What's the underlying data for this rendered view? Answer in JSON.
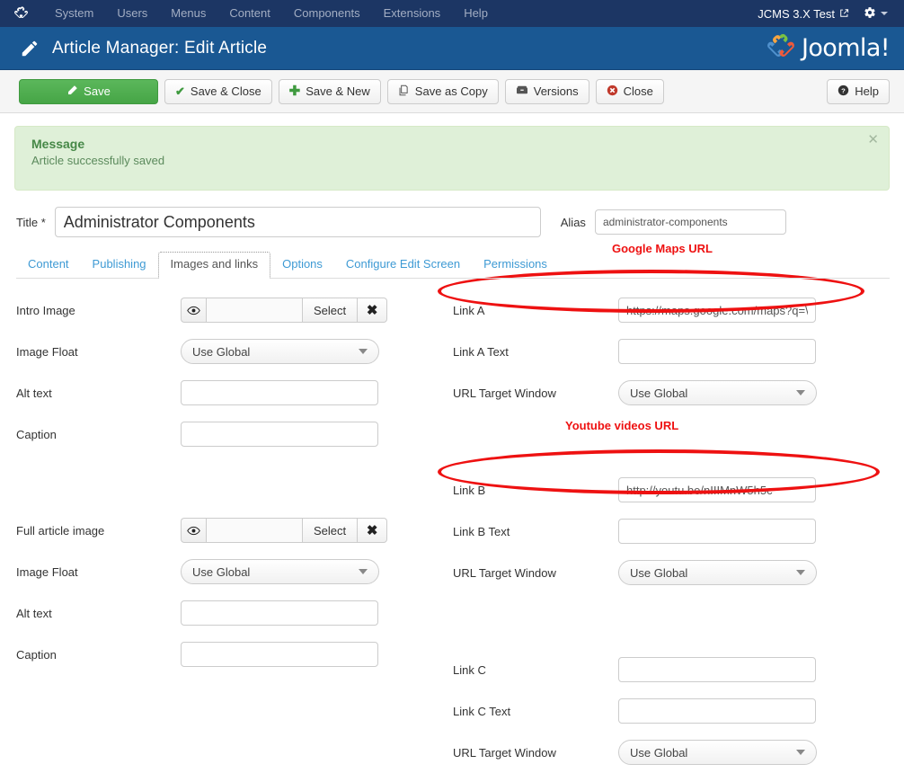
{
  "topbar": {
    "brand_icon": "joomla-logo-icon",
    "menu": [
      {
        "label": "System"
      },
      {
        "label": "Users"
      },
      {
        "label": "Menus"
      },
      {
        "label": "Content"
      },
      {
        "label": "Components"
      },
      {
        "label": "Extensions"
      },
      {
        "label": "Help"
      }
    ],
    "site_name": "JCMS 3.X Test",
    "site_link_icon": "external-link-icon",
    "gear_icon": "gear-icon",
    "caret_icon": "chevron-down-icon"
  },
  "titlebar": {
    "icon": "pencil-icon",
    "title": "Article Manager: Edit Article",
    "logo_text": "Joomla!"
  },
  "toolbar": {
    "save": "Save",
    "save_close": "Save & Close",
    "save_new": "Save & New",
    "save_copy": "Save as Copy",
    "versions": "Versions",
    "close": "Close",
    "help": "Help"
  },
  "alert": {
    "title": "Message",
    "text": "Article successfully saved",
    "close_icon": "close-icon"
  },
  "title_row": {
    "title_label": "Title *",
    "title_value": "Administrator Components",
    "alias_label": "Alias",
    "alias_value": "administrator-components"
  },
  "tabs": [
    {
      "label": "Content",
      "active": false
    },
    {
      "label": "Publishing",
      "active": false
    },
    {
      "label": "Images and links",
      "active": true
    },
    {
      "label": "Options",
      "active": false
    },
    {
      "label": "Configure Edit Screen",
      "active": false
    },
    {
      "label": "Permissions",
      "active": false
    }
  ],
  "left_column": {
    "intro_image": {
      "label": "Intro Image",
      "value": "",
      "select_label": "Select",
      "clear_label": "✖",
      "eye_icon": "eye-icon"
    },
    "intro_float": {
      "label": "Image Float",
      "value": "Use Global"
    },
    "intro_alt": {
      "label": "Alt text",
      "value": ""
    },
    "intro_caption": {
      "label": "Caption",
      "value": ""
    },
    "full_image": {
      "label": "Full article image",
      "value": "",
      "select_label": "Select",
      "clear_label": "✖",
      "eye_icon": "eye-icon"
    },
    "full_float": {
      "label": "Image Float",
      "value": "Use Global"
    },
    "full_alt": {
      "label": "Alt text",
      "value": ""
    },
    "full_caption": {
      "label": "Caption",
      "value": ""
    }
  },
  "right_column": {
    "link_a": {
      "label": "Link A",
      "value": "https://maps.google.com/maps?q=\\"
    },
    "link_a_text": {
      "label": "Link A Text",
      "value": ""
    },
    "link_a_target": {
      "label": "URL Target Window",
      "value": "Use Global"
    },
    "link_b": {
      "label": "Link B",
      "value": "http://youtu.be/nIIIMnW5h5c"
    },
    "link_b_text": {
      "label": "Link B Text",
      "value": ""
    },
    "link_b_target": {
      "label": "URL Target Window",
      "value": "Use Global"
    },
    "link_c": {
      "label": "Link C",
      "value": ""
    },
    "link_c_text": {
      "label": "Link C Text",
      "value": ""
    },
    "link_c_target": {
      "label": "URL Target Window",
      "value": "Use Global"
    }
  },
  "annotations": {
    "maps_label": "Google Maps URL",
    "youtube_label": "Youtube videos URL",
    "color": "#ee1111"
  },
  "colors": {
    "topbar_bg": "#1c3664",
    "titlebar_bg": "#1a5893",
    "save_green": "#46a546",
    "alert_bg": "#dff0d8",
    "link_blue": "#3e9ad4",
    "annotation_red": "#ee1111"
  }
}
